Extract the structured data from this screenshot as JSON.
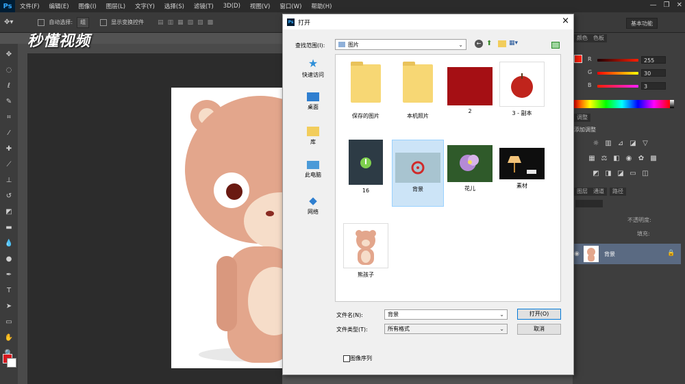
{
  "app": {
    "logo": "Ps"
  },
  "menu": [
    "文件(F)",
    "编辑(E)",
    "图像(I)",
    "图层(L)",
    "文字(Y)",
    "选择(S)",
    "滤镜(T)",
    "3D(D)",
    "视图(V)",
    "窗口(W)",
    "帮助(H)"
  ],
  "options_bar": {
    "auto_select_label": "自动选择:",
    "auto_select_value": "组",
    "show_transform_label": "显示变换控件",
    "workspace": "基本功能"
  },
  "watermark": "秒懂视频",
  "color_panel": {
    "tabs": [
      "颜色",
      "色板"
    ],
    "r_label": "R",
    "r_value": "255",
    "g_label": "G",
    "g_value": "30",
    "b_label": "B",
    "b_value": "3",
    "foreground": "#ff1e03"
  },
  "adjustments_panel": {
    "title": "添加调整"
  },
  "layers_panel": {
    "tabs": [
      "图层",
      "通道",
      "路径"
    ],
    "opacity_label": "不透明度:",
    "fill_label": "填充:",
    "layer_name": "背景"
  },
  "dialog": {
    "title": "打开",
    "close_icon": "×",
    "lookin_label": "查找范围(I):",
    "lookin_value": "图片",
    "nav": [
      "快速访问",
      "桌面",
      "库",
      "此电脑",
      "网络"
    ],
    "files": [
      {
        "name": "保存的图片",
        "kind": "folder"
      },
      {
        "name": "本机照片",
        "kind": "folder"
      },
      {
        "name": "2",
        "kind": "red"
      },
      {
        "name": "3 - 副本",
        "kind": "apple"
      },
      {
        "name": "16",
        "kind": "bulb"
      },
      {
        "name": "背景",
        "kind": "target",
        "selected": true
      },
      {
        "name": "花儿",
        "kind": "flower"
      },
      {
        "name": "素材",
        "kind": "lamp"
      },
      {
        "name": "熊孩子",
        "kind": "bear"
      }
    ],
    "filename_label": "文件名(N):",
    "filename_value": "背景",
    "filetype_label": "文件类型(T):",
    "filetype_value": "所有格式",
    "open_button": "打开(O)",
    "cancel_button": "取消",
    "image_sequence_label": "图像序列",
    "image_sequence_checked": false
  }
}
